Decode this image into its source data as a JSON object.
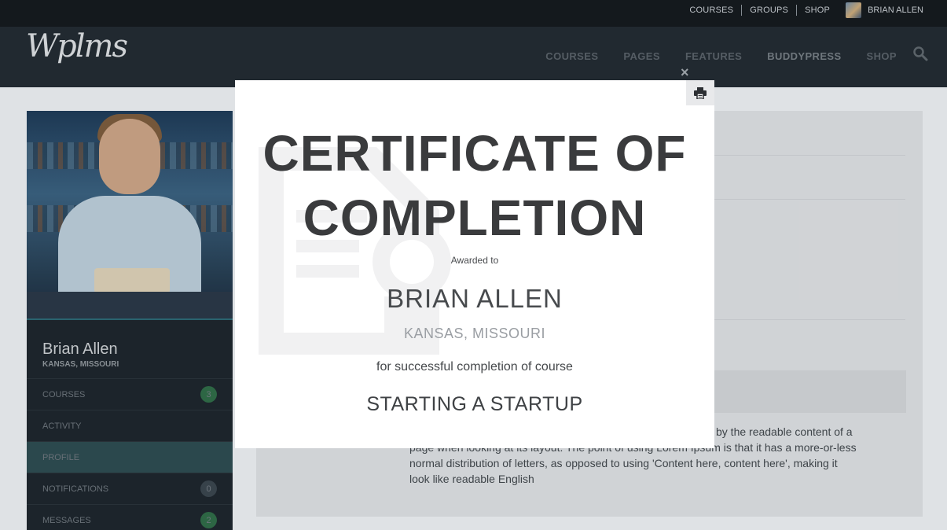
{
  "topbar": {
    "links": [
      "COURSES",
      "GROUPS",
      "SHOP"
    ],
    "user_name": "BRIAN ALLEN"
  },
  "header": {
    "logo_text": "Wplms",
    "nav": [
      "COURSES",
      "PAGES",
      "FEATURES",
      "BUDDYPRESS",
      "SHOP"
    ],
    "active_nav": "BUDDYPRESS"
  },
  "sidebar": {
    "name": "Brian Allen",
    "location": "KANSAS, MISSOURI",
    "items": [
      {
        "label": "COURSES",
        "count": "3"
      },
      {
        "label": "ACTIVITY",
        "count": ""
      },
      {
        "label": "PROFILE",
        "count": ""
      },
      {
        "label": "NOTIFICATIONS",
        "count": "0"
      },
      {
        "label": "MESSAGES",
        "count": "2"
      }
    ],
    "active_item": "PROFILE"
  },
  "content": {
    "lines": [
      "by the readable content of a",
      "page when looking at its layout. The point of using Lorem Ipsum is that it has a more-or-less",
      "normal distribution of letters, as opposed to using 'Content here, content here', making it",
      "look like readable English"
    ]
  },
  "certificate": {
    "title_line1": "CERTIFICATE OF",
    "title_line2": "COMPLETION",
    "awarded_to": "Awarded to",
    "recipient": "BRIAN ALLEN",
    "location": "KANSAS, MISSOURI",
    "for_course": "for successful completion of course",
    "course": "STARTING A STARTUP",
    "close_symbol": "×",
    "print_icon": "printer-icon"
  },
  "colors": {
    "topbar": "#15191e",
    "header": "#232a31",
    "modal": "#ffffff",
    "title": "#3a3b3d"
  }
}
